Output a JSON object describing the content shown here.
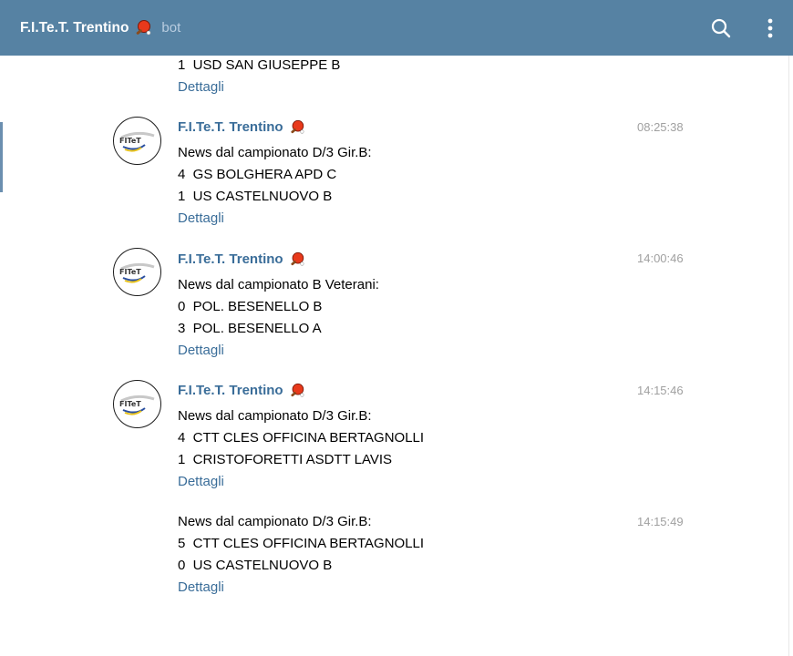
{
  "header": {
    "title": "F.I.Te.T. Trentino",
    "subtitle": "bot",
    "colors": {
      "bar": "#5682a3",
      "link": "#3a6d99"
    }
  },
  "partial": {
    "line": "1  USD SAN GIUSEPPE B",
    "link": "Dettagli"
  },
  "messages": [
    {
      "sender": "F.I.Te.T. Trentino",
      "time": "08:25:38",
      "lines": [
        "News dal campionato D/3 Gir.B:",
        "4  GS BOLGHERA APD C",
        "1  US CASTELNUOVO B"
      ],
      "link": "Dettagli"
    },
    {
      "sender": "F.I.Te.T. Trentino",
      "time": "14:00:46",
      "lines": [
        "News dal campionato B Veterani:",
        "0  POL. BESENELLO B",
        "3  POL. BESENELLO A"
      ],
      "link": "Dettagli"
    },
    {
      "sender": "F.I.Te.T. Trentino",
      "time": "14:15:46",
      "lines": [
        "News dal campionato D/3 Gir.B:",
        "4  CTT CLES OFFICINA BERTAGNOLLI",
        "1  CRISTOFORETTI ASDTT LAVIS"
      ],
      "link": "Dettagli"
    },
    {
      "time": "14:15:49",
      "lines": [
        "News dal campionato D/3 Gir.B:",
        "5  CTT CLES OFFICINA BERTAGNOLLI",
        "0  US CASTELNUOVO B"
      ],
      "link": "Dettagli"
    }
  ],
  "logo": {
    "text": "FITeT"
  }
}
